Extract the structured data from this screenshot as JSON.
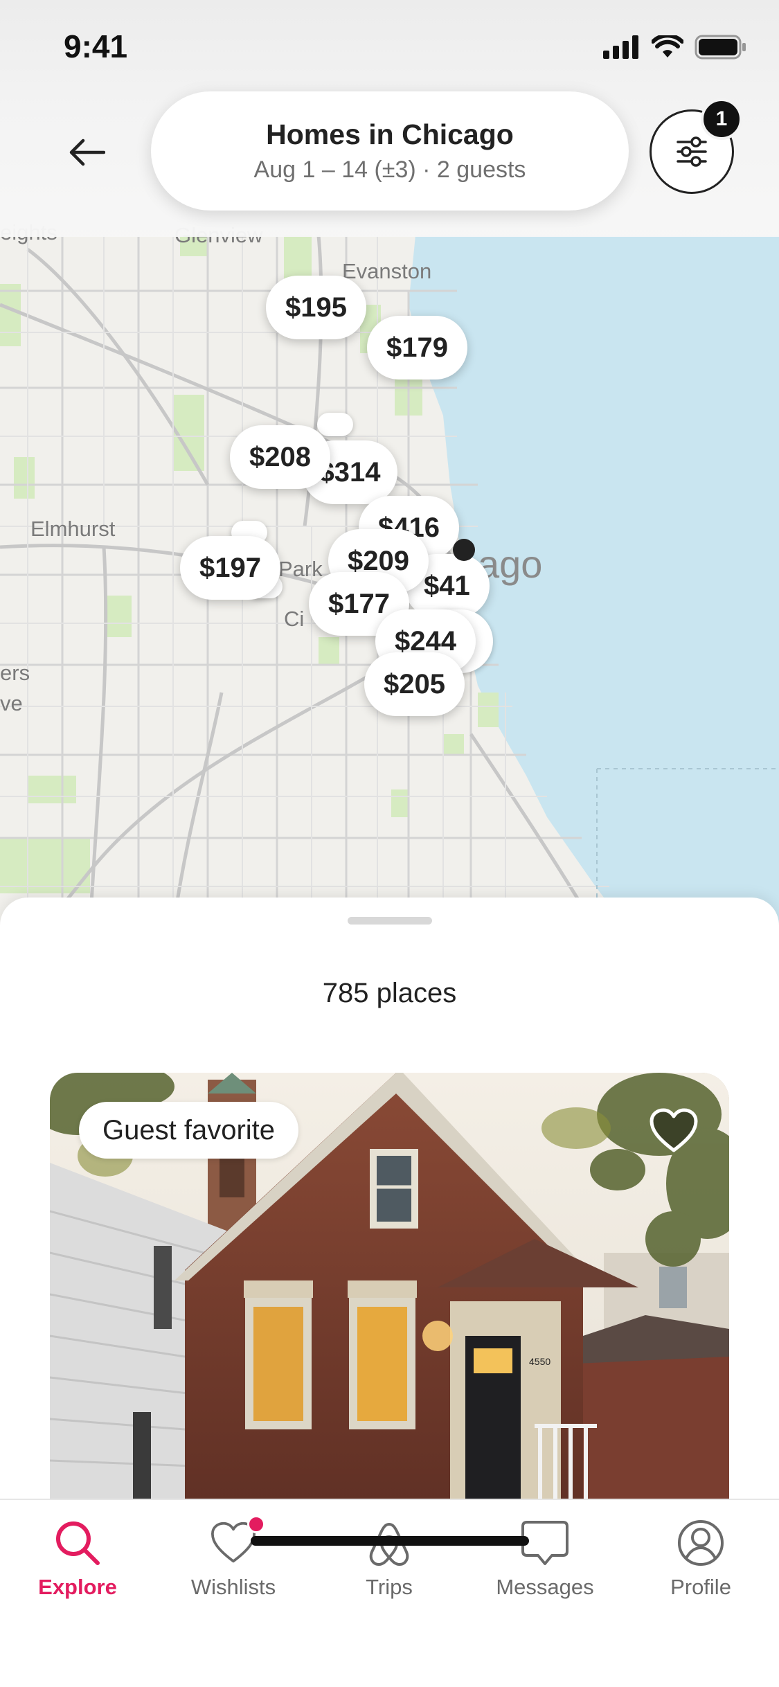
{
  "status_bar": {
    "time": "9:41"
  },
  "header": {
    "title": "Homes in Chicago",
    "subtitle": "Aug 1 – 14 (±3) · 2 guests",
    "filter_badge_count": "1"
  },
  "map": {
    "labels": {
      "heights": "eights",
      "glenview": "Glenview",
      "evanston": "Evanston",
      "elmhurst": "Elmhurst",
      "park": "Park",
      "cicero": "Ci",
      "chicago": "ago",
      "edge_ers": "ers",
      "edge_ve": "ve"
    },
    "price_pins": [
      "$195",
      "$179",
      "$208",
      "$314",
      "$416",
      "$197",
      "$209",
      "$41",
      "$177",
      "$244",
      "$205"
    ]
  },
  "sheet": {
    "places_count": "785 places",
    "listing": {
      "badge": "Guest favorite",
      "house_number": "4550"
    }
  },
  "tabs": [
    {
      "label": "Explore",
      "icon": "search-icon",
      "active": true
    },
    {
      "label": "Wishlists",
      "icon": "heart-icon",
      "active": false
    },
    {
      "label": "Trips",
      "icon": "airbnb-logo-icon",
      "active": false
    },
    {
      "label": "Messages",
      "icon": "message-icon",
      "active": false
    },
    {
      "label": "Profile",
      "icon": "profile-icon",
      "active": false
    }
  ],
  "colors": {
    "accent": "#e31c5f",
    "water": "#c9e5f0",
    "map_land": "#f1f0ec",
    "park_green": "#d6ebc1"
  }
}
